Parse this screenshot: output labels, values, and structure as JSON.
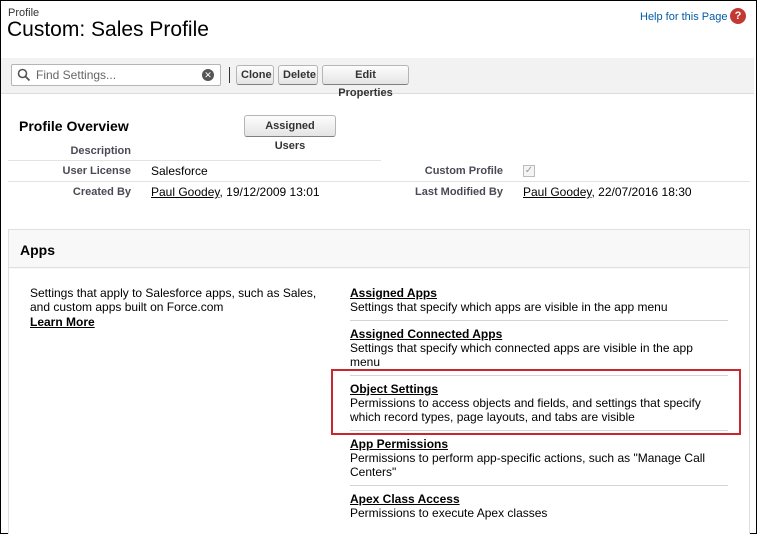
{
  "header": {
    "type_label": "Profile",
    "title": "Custom: Sales Profile",
    "help_link": "Help for this Page",
    "help_icon_glyph": "?"
  },
  "toolbar": {
    "search_placeholder": "Find Settings...",
    "clone_label": "Clone",
    "delete_label": "Delete",
    "edit_label": "Edit Properties"
  },
  "overview": {
    "title": "Profile Overview",
    "assigned_users_label": "Assigned Users",
    "description_label": "Description",
    "user_license_label": "User License",
    "user_license_value": "Salesforce",
    "custom_profile_label": "Custom Profile",
    "custom_profile_checked": true,
    "created_by_label": "Created By",
    "created_by_user": "Paul Goodey",
    "created_by_date": ", 19/12/2009 13:01",
    "last_modified_label": "Last Modified By",
    "last_modified_user": "Paul Goodey",
    "last_modified_date": ", 22/07/2016 18:30"
  },
  "apps": {
    "title": "Apps",
    "description": "Settings that apply to Salesforce apps, such as Sales, and custom apps built on Force.com",
    "learn_more": "Learn More",
    "items": [
      {
        "label": "Assigned Apps",
        "desc": "Settings that specify which apps are visible in the app menu"
      },
      {
        "label": "Assigned Connected Apps",
        "desc": "Settings that specify which connected apps are visible in the app menu"
      },
      {
        "label": "Object Settings",
        "desc": "Permissions to access objects and fields, and settings that specify which record types, page layouts, and tabs are visible",
        "highlighted": true
      },
      {
        "label": "App Permissions",
        "desc": "Permissions to perform app-specific actions, such as \"Manage Call Centers\""
      },
      {
        "label": "Apex Class Access",
        "desc": "Permissions to execute Apex classes"
      }
    ]
  },
  "colors": {
    "link": "#015ba7",
    "highlight": "#c9272f",
    "help_icon": "#c23934"
  },
  "icons": {
    "search": "search-icon",
    "clear": "clear-search-icon",
    "help": "help-icon",
    "checkbox": "checkbox-checked-icon"
  }
}
